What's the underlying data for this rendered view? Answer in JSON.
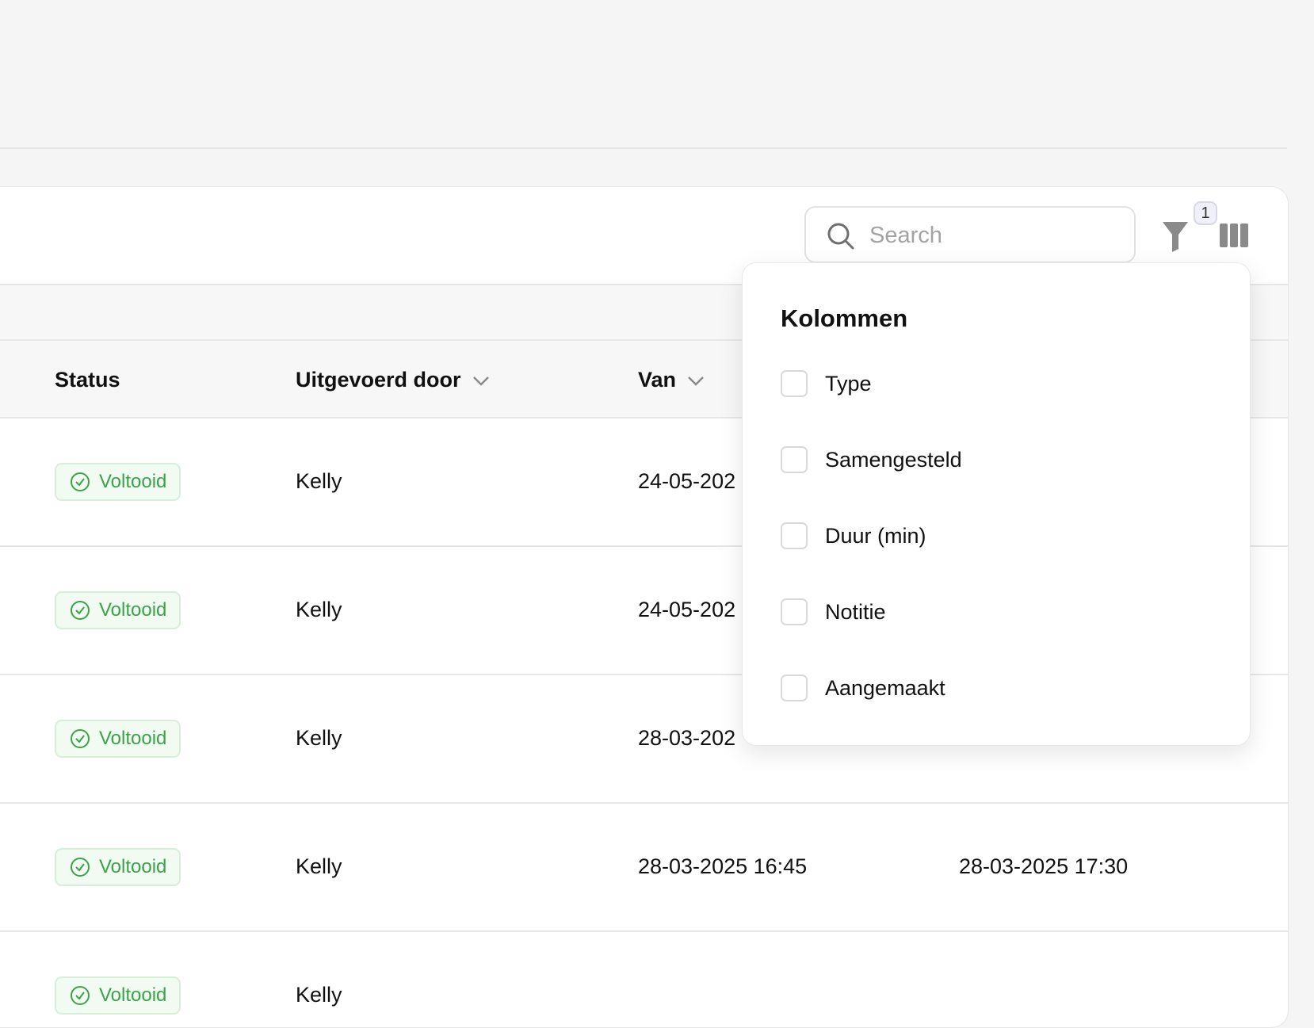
{
  "toolbar": {
    "search_placeholder": "Search",
    "filter_count": "1"
  },
  "table": {
    "columns": [
      {
        "label": "Status",
        "sortable": false
      },
      {
        "label": "Uitgevoerd door",
        "sortable": true
      },
      {
        "label": "Van",
        "sortable": true
      }
    ],
    "rows": [
      {
        "status": "Voltooid",
        "user": "Kelly",
        "from": "24-05-202",
        "to": ""
      },
      {
        "status": "Voltooid",
        "user": "Kelly",
        "from": "24-05-202",
        "to": ""
      },
      {
        "status": "Voltooid",
        "user": "Kelly",
        "from": "28-03-202",
        "to": ""
      },
      {
        "status": "Voltooid",
        "user": "Kelly",
        "from": "28-03-2025 16:45",
        "to": "28-03-2025 17:30"
      },
      {
        "status": "Voltooid",
        "user": "Kelly",
        "from": "",
        "to": ""
      }
    ]
  },
  "columns_menu": {
    "title": "Kolommen",
    "options": [
      {
        "label": "Type",
        "checked": false
      },
      {
        "label": "Samengesteld",
        "checked": false
      },
      {
        "label": "Duur (min)",
        "checked": false
      },
      {
        "label": "Notitie",
        "checked": false
      },
      {
        "label": "Aangemaakt",
        "checked": false
      }
    ]
  },
  "colors": {
    "status_green": "#3aa34a",
    "status_bg": "#f2fbf2",
    "icon_gray": "#8a8a8a"
  }
}
